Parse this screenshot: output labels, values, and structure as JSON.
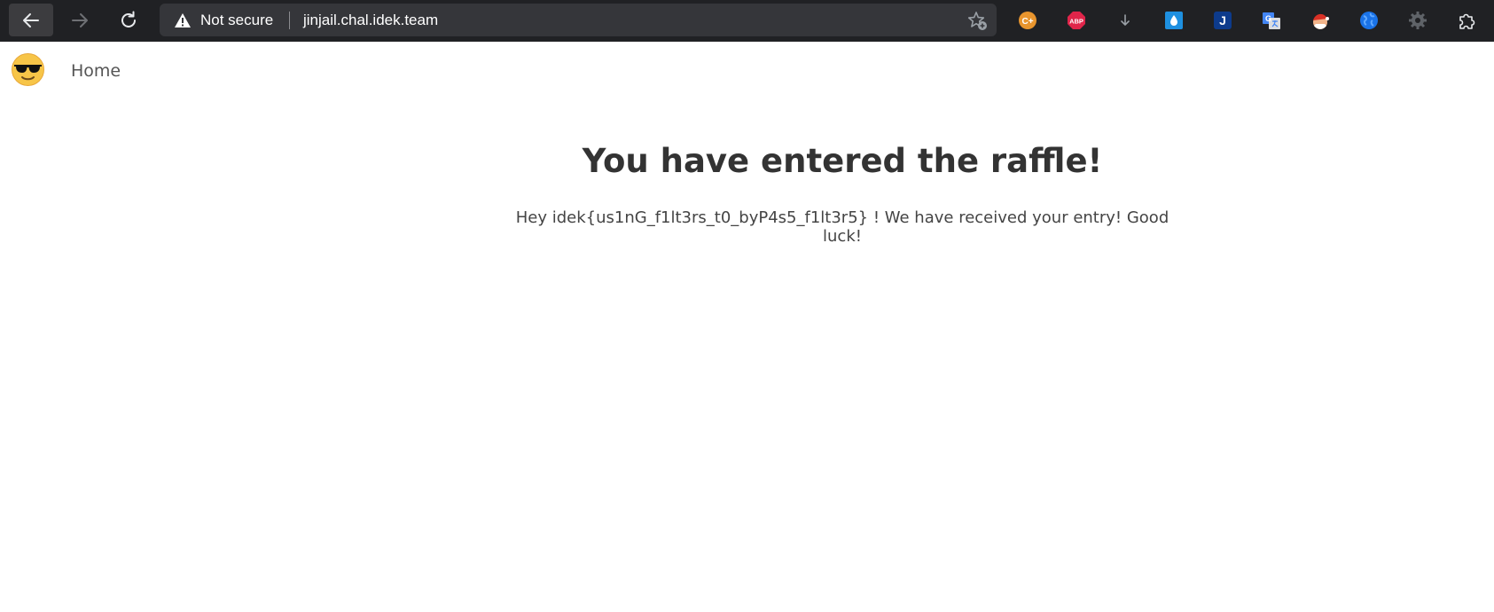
{
  "browser": {
    "security_label": "Not secure",
    "url": "jinjail.chal.idek.team",
    "extensions": [
      {
        "name": "coupon-extension",
        "label": "C+",
        "color": "#e8952e"
      },
      {
        "name": "adblock-plus",
        "label": "ABP",
        "color": "#e0254a"
      },
      {
        "name": "downloads",
        "label": "",
        "color": "#9aa0a6"
      },
      {
        "name": "raindrop",
        "label": "",
        "color": "#1e90e0"
      },
      {
        "name": "j-extension",
        "label": "J",
        "color": "#0d3b8c"
      },
      {
        "name": "google-translate",
        "label": "G",
        "color": "#4285f4"
      },
      {
        "name": "santa-extension",
        "label": "",
        "color": "#d93025"
      },
      {
        "name": "globe-extension",
        "label": "",
        "color": "#1a73e8"
      },
      {
        "name": "gear-extension",
        "label": "",
        "color": "#5f6368"
      },
      {
        "name": "extensions-menu",
        "label": "",
        "color": "#e8eaed"
      }
    ]
  },
  "nav": {
    "home_label": "Home"
  },
  "main": {
    "title": "You have entered the raffle!",
    "message": "Hey idek{us1nG_f1lt3rs_t0_byP4s5_f1lt3r5} ! We have received your entry! Good luck!"
  }
}
